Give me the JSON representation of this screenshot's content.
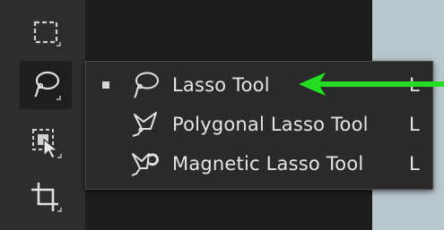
{
  "flyout": {
    "items": [
      {
        "label": "Lasso Tool",
        "shortcut": "L",
        "icon": "lasso-icon",
        "selected": true
      },
      {
        "label": "Polygonal Lasso Tool",
        "shortcut": "L",
        "icon": "polygonal-lasso-icon",
        "selected": false
      },
      {
        "label": "Magnetic Lasso Tool",
        "shortcut": "L",
        "icon": "magnetic-lasso-icon",
        "selected": false
      }
    ]
  },
  "toolbar": {
    "tools": [
      {
        "icon": "marquee-icon"
      },
      {
        "icon": "lasso-icon",
        "active": true
      },
      {
        "icon": "object-selection-icon"
      },
      {
        "icon": "crop-icon"
      }
    ]
  },
  "annotation": {
    "arrow_color": "#22dd22"
  }
}
